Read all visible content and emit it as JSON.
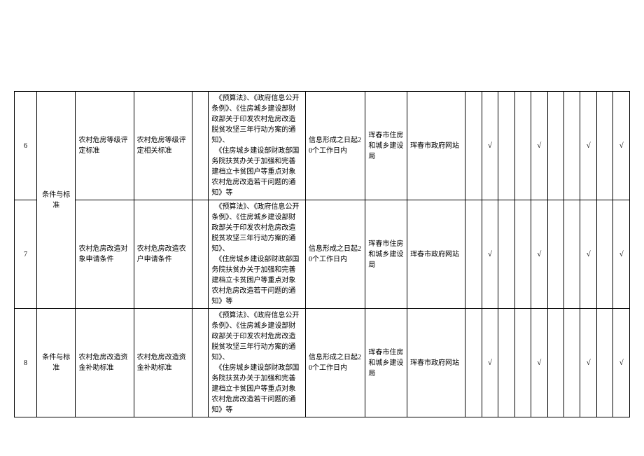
{
  "marks": {
    "check": "√"
  },
  "rows": [
    {
      "idx": "6",
      "category": "条件与标准",
      "name": "农村危房等级评定标准",
      "content": "农村危房等级评定相关标准",
      "basis": "　《预算法》、《政府信息公开条例》、《住房城乡建设部财政部关于印发农村危房改造脱贫攻坚三年行动方案的通知》、\n　《住房城乡建设部财政部国务院扶贫办关于加强和完善建档立卡贫困户等重点对象农村危房改造若干问题的通知》等",
      "time": "信息形成之日起20个工作日内",
      "dept": "珲春市住房和城乡建设局",
      "channel": "珲春市政府网站",
      "m1": true,
      "m2": false,
      "m3": true,
      "m4": false,
      "m5": true,
      "m6": true
    },
    {
      "idx": "7",
      "category": "",
      "name": "农村危房改造对象申请条件",
      "content": "农村危房改造农户申请条件",
      "basis": "　《预算法》、《政府信息公开条例》、《住房城乡建设部财政部关于印发农村危房改造脱贫攻坚三年行动方案的通知》、\n　《住房城乡建设部财政部国务院扶贫办关于加强和完善建档立卡贫困户等重点对象农村危房改造若干问题的通知》等",
      "time": "信息形成之日起20个工作日内",
      "dept": "珲春市住房和城乡建设局",
      "channel": "珲春市政府网站",
      "m1": true,
      "m2": false,
      "m3": true,
      "m4": false,
      "m5": true,
      "m6": true
    },
    {
      "idx": "8",
      "category": "条件与标准",
      "name": "农村危房改造资金补助标准",
      "content": "农村危房改造资金补助标准",
      "basis": "　《预算法》、《政府信息公开条例》、《住房城乡建设部财政部关于印发农村危房改造脱贫攻坚三年行动方案的通知》、\n　《住房城乡建设部财政部国务院扶贫办关于加强和完善建档立卡贫困户等重点对象农村危房改造若干问题的通知》等",
      "time": "信息形成之日起20个工作日内",
      "dept": "珲春市住房和城乡建设局",
      "channel": "珲春市政府网站",
      "m1": true,
      "m2": false,
      "m3": true,
      "m4": false,
      "m5": true,
      "m6": true
    }
  ]
}
